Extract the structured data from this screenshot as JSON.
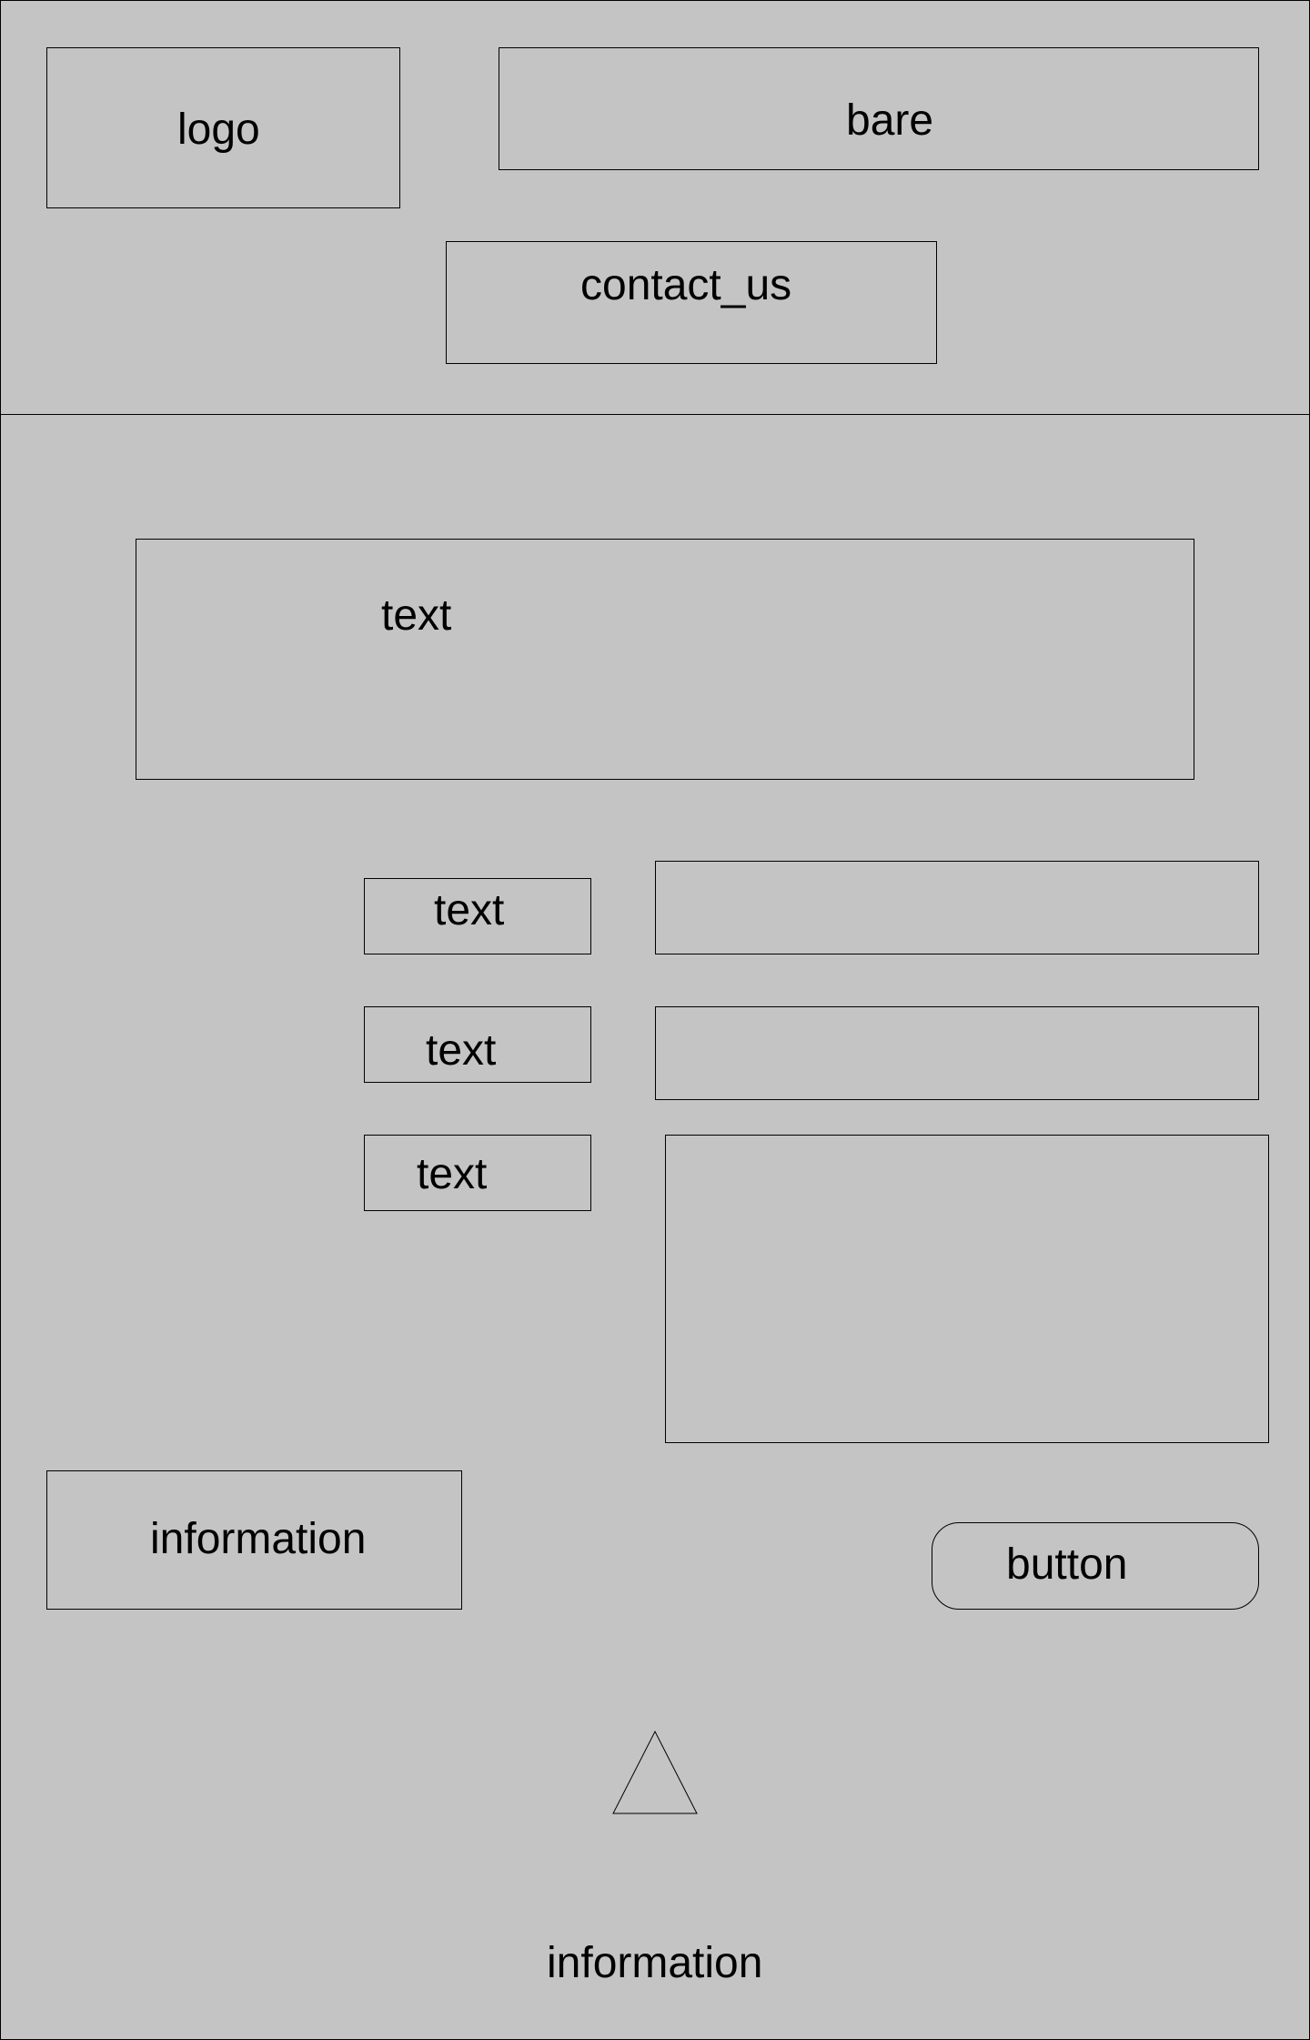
{
  "header": {
    "logo_label": "logo",
    "bar_label": "bare",
    "contact_label": "contact_us"
  },
  "main": {
    "intro_text": "text",
    "form": {
      "fields": [
        {
          "label": "text",
          "value": ""
        },
        {
          "label": "text",
          "value": ""
        },
        {
          "label": "text",
          "value": ""
        }
      ]
    },
    "info_label": "information",
    "button_label": "button",
    "arrow_icon": "triangle-up-icon"
  },
  "footer": {
    "info_label": "information"
  }
}
